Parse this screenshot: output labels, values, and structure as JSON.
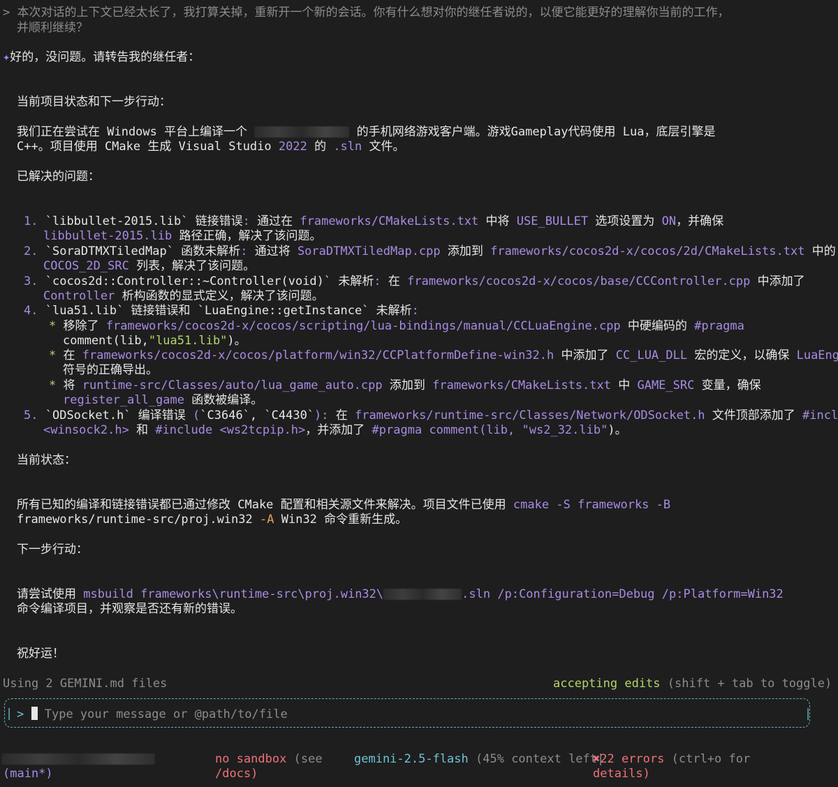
{
  "user_prompt": {
    "marker": ">",
    "line1": "本次对话的上下文已经太长了，我打算关掉，重新开一个新的会话。你有什么想对你的继任者说的，以便它能更好的理解你当前的工作，",
    "line2": "并顺利继续？"
  },
  "reply": {
    "star": "✦",
    "greeting": "好的，没问题。请转告我的继任者：",
    "section_status_next": "当前项目状态和下一步行动：",
    "intro_a": "我们正在尝试在 Windows 平台上编译一个",
    "intro_b": "的手机网络游戏客户端。游戏Gameplay代码使用 Lua，底层引擎是",
    "intro_c": "C++。项目使用 CMake 生成 Visual Studio ",
    "intro_year": "2022",
    "intro_d": " 的 ",
    "intro_sln": ".sln",
    "intro_e": " 文件。",
    "section_solved": "已解决的问题：",
    "items": {
      "i1": {
        "num": "1.",
        "a": "`libbullet-2015.lib` 链接错误",
        "colon": ":",
        "b": " 通过在 ",
        "p1": "frameworks/CMakeLists.txt",
        "c": " 中将 ",
        "p2": "USE_BULLET",
        "d": " 选项设置为 ",
        "p3": "ON",
        "e": "，并确保",
        "p4": "libbullet-2015.lib",
        "f": " 路径正确，解决了该问题。"
      },
      "i2": {
        "num": "2.",
        "a": "`SoraDTMXTiledMap` 函数未解析",
        "colon": ":",
        "b": " 通过将 ",
        "p1": "SoraDTMXTiledMap.cpp",
        "c": " 添加到 ",
        "p2": "frameworks/cocos2d-x/cocos/2d/CMakeLists.txt",
        "d": " 中的",
        "p3": "COCOS_2D_SRC",
        "e": " 列表，解决了该问题。"
      },
      "i3": {
        "num": "3.",
        "a": "`cocos2d::Controller::~Controller(void)` 未解析",
        "colon": ":",
        "b": " 在 ",
        "p1": "frameworks/cocos2d-x/cocos/base/CCController.cpp",
        "c": " 中添加了",
        "p2": "Controller",
        "d": " 析构函数的显式定义，解决了该问题。"
      },
      "i4": {
        "num": "4.",
        "a": "`lua51.lib` 链接错误和 `LuaEngine::getInstance` 未解析",
        "colon": ":",
        "s1a": "移除了 ",
        "s1p": "frameworks/cocos2d-x/cocos/scripting/lua-bindings/manual/CCLuaEngine.cpp",
        "s1b": " 中硬编码的 ",
        "s1c": "#pragma",
        "s1d": "comment(lib,",
        "s1e": "\"lua51.lib\"",
        "s1f": ")。",
        "s2a": "在 ",
        "s2p": "frameworks/cocos2d-x/cocos/platform/win32/CCPlatformDefine-win32.h",
        "s2b": " 中添加了 ",
        "s2c": "CC_LUA_DLL",
        "s2d": " 宏的定义，以确保 ",
        "s2e": "LuaEngine",
        "s2f": "符号的正确导出。",
        "s3a": "将 ",
        "s3p": "runtime-src/Classes/auto/lua_game_auto.cpp",
        "s3b": " 添加到 ",
        "s3c": "frameworks/CMakeLists.txt",
        "s3d": " 中 ",
        "s3e": "GAME_SRC",
        "s3f": " 变量，确保",
        "s3g": "register_all_game",
        "s3h": " 函数被编译。"
      },
      "i5": {
        "num": "5.",
        "a": "`ODSocket.h` 编译错误 ",
        "paren": "(",
        "c1": "`C3646`, `C4430`",
        "paren2": ")",
        "colon": ":",
        "b": " 在 ",
        "p1": "frameworks/runtime-src/Classes/Network/ODSocket.h",
        "c": " 文件顶部添加了 ",
        "p2": "#include",
        "p3": "<winsock2.h>",
        "d": " 和 ",
        "p4": "#include",
        "p5": "<ws2tcpip.h>",
        "e": "，并添加了 ",
        "p6": "#pragma",
        "p7": "comment(lib,",
        "p8": "\"ws2_32.lib\"",
        "f": ")。"
      }
    },
    "section_current": "当前状态：",
    "current_a": "所有已知的编译和链接错误都已通过修改 CMake 配置和相关源文件来解决。项目文件已使用 ",
    "cmd_cmake": "cmake",
    "cmd_S": "-S",
    "cmd_fw": "frameworks",
    "cmd_B": "-B",
    "current_b": "frameworks/runtime-src/proj.win32",
    "cmd_A": "-A",
    "current_c": " Win32 命令重新生成。",
    "section_next": "下一步行动：",
    "next_a": "请尝试使用 ",
    "cmd_msbuild": "msbuild",
    "cmd_path": "frameworks\\runtime-src\\proj.win32\\",
    "cmd_sln": ".sln",
    "cmd_cfg": "/p:Configuration=Debug",
    "cmd_plat": "/p:Platform=Win32",
    "next_b": "命令编译项目，并观察是否还有新的错误。",
    "closing": "祝好运！"
  },
  "footer": {
    "gemini_files": "Using 2 GEMINI.md files",
    "accepting": "accepting edits",
    "toggle_hint": "(shift + tab to toggle)",
    "prompt_marker": ">",
    "input_placeholder": "Type your message or @path/to/file",
    "branch": "(main*)",
    "sandbox": "no sandbox",
    "sandbox_hint_a": "(see",
    "sandbox_hint_b": "/docs)",
    "model": "gemini-2.5-flash",
    "context": "(45% context left|",
    "error_icon": "✖",
    "errors": "22 errors",
    "errors_hint_a": "(ctrl+o for",
    "errors_hint_b": "details)"
  },
  "colors": {
    "background": "#1e1e1e",
    "text": "#e6e6e6",
    "path": "#a88be4",
    "accent_green": "#b5d46b",
    "accent_cyan": "#6ec3d6",
    "error_red": "#f07178"
  }
}
